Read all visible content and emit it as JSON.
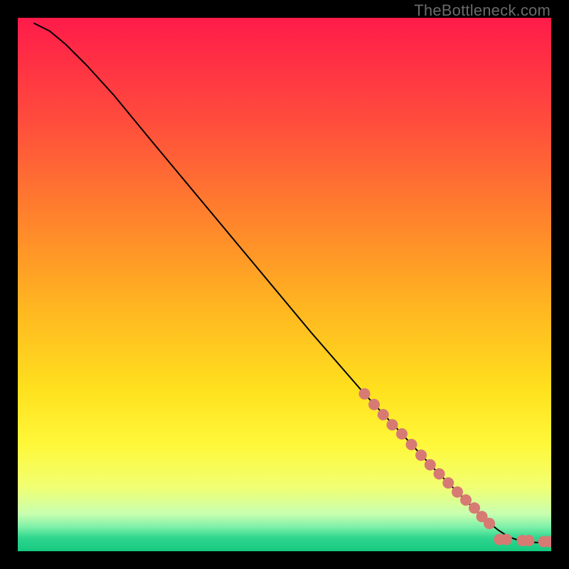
{
  "watermark": "TheBottleneck.com",
  "chart_data": {
    "type": "line",
    "title": "",
    "xlabel": "",
    "ylabel": "",
    "xlim": [
      0,
      100
    ],
    "ylim": [
      0,
      100
    ],
    "grid": false,
    "legend": false,
    "background": {
      "type": "vertical-gradient",
      "stops": [
        {
          "pos": 0.0,
          "color": "#ff1b4a"
        },
        {
          "pos": 0.2,
          "color": "#ff4e3c"
        },
        {
          "pos": 0.4,
          "color": "#ff8a2a"
        },
        {
          "pos": 0.55,
          "color": "#ffb820"
        },
        {
          "pos": 0.7,
          "color": "#ffe11e"
        },
        {
          "pos": 0.8,
          "color": "#fff83a"
        },
        {
          "pos": 0.88,
          "color": "#f1ff72"
        },
        {
          "pos": 0.93,
          "color": "#c8ffb0"
        },
        {
          "pos": 0.955,
          "color": "#7cf0a8"
        },
        {
          "pos": 0.975,
          "color": "#2fd68f"
        },
        {
          "pos": 1.0,
          "color": "#16c97f"
        }
      ]
    },
    "curve": {
      "comment": "main black curve, x in 0..100 normalized horizontal, y in 0..100 (100=top)",
      "points": [
        {
          "x": 3.0,
          "y": 99.0
        },
        {
          "x": 6.0,
          "y": 97.5
        },
        {
          "x": 9.0,
          "y": 95.0
        },
        {
          "x": 13.0,
          "y": 91.0
        },
        {
          "x": 18.0,
          "y": 85.5
        },
        {
          "x": 25.0,
          "y": 77.0
        },
        {
          "x": 35.0,
          "y": 65.0
        },
        {
          "x": 45.0,
          "y": 53.0
        },
        {
          "x": 55.0,
          "y": 41.0
        },
        {
          "x": 65.0,
          "y": 29.5
        },
        {
          "x": 72.0,
          "y": 22.0
        },
        {
          "x": 78.0,
          "y": 15.5
        },
        {
          "x": 83.0,
          "y": 10.5
        },
        {
          "x": 87.0,
          "y": 6.5
        },
        {
          "x": 90.0,
          "y": 4.0
        },
        {
          "x": 92.0,
          "y": 2.7
        },
        {
          "x": 94.0,
          "y": 2.0
        },
        {
          "x": 96.0,
          "y": 1.7
        },
        {
          "x": 98.0,
          "y": 1.6
        },
        {
          "x": 99.5,
          "y": 1.6
        }
      ]
    },
    "markers": {
      "comment": "salmon/pink dotted markers along lower segment of curve",
      "color": "#d77a74",
      "radius_px": 8,
      "points": [
        {
          "x": 65.0,
          "y": 29.5
        },
        {
          "x": 66.8,
          "y": 27.5
        },
        {
          "x": 68.5,
          "y": 25.6
        },
        {
          "x": 70.2,
          "y": 23.7
        },
        {
          "x": 72.0,
          "y": 22.0
        },
        {
          "x": 73.8,
          "y": 20.0
        },
        {
          "x": 75.6,
          "y": 18.0
        },
        {
          "x": 77.3,
          "y": 16.2
        },
        {
          "x": 79.0,
          "y": 14.5
        },
        {
          "x": 80.7,
          "y": 12.8
        },
        {
          "x": 82.4,
          "y": 11.1
        },
        {
          "x": 84.0,
          "y": 9.6
        },
        {
          "x": 85.6,
          "y": 8.1
        },
        {
          "x": 87.0,
          "y": 6.5
        },
        {
          "x": 88.4,
          "y": 5.2
        },
        {
          "x": 90.3,
          "y": 2.2
        },
        {
          "x": 91.6,
          "y": 2.2
        },
        {
          "x": 94.6,
          "y": 2.0
        },
        {
          "x": 95.8,
          "y": 2.0
        },
        {
          "x": 98.6,
          "y": 1.8
        },
        {
          "x": 99.7,
          "y": 1.8
        }
      ]
    }
  }
}
